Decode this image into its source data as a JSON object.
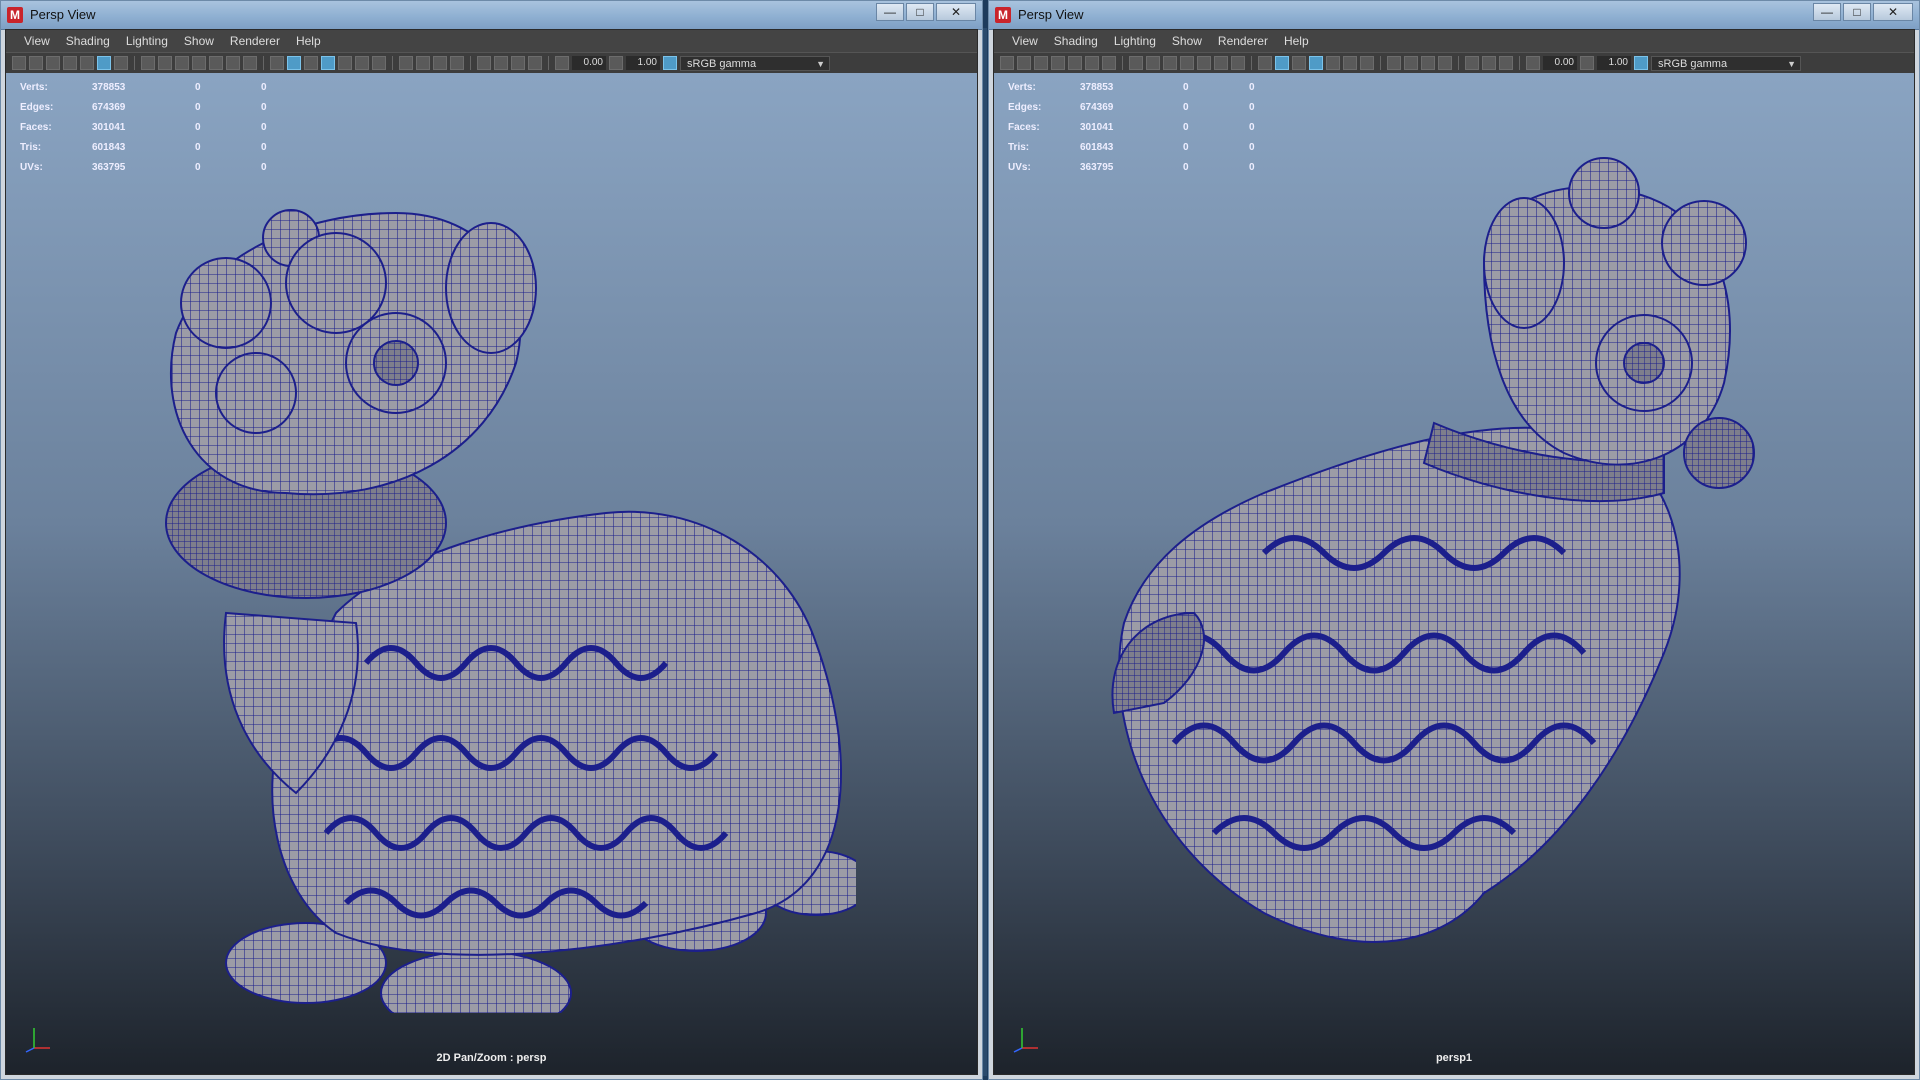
{
  "window_left": {
    "title": "Persp View",
    "menu": [
      "View",
      "Shading",
      "Lighting",
      "Show",
      "Renderer",
      "Help"
    ],
    "exposure": "0.00",
    "gamma": "1.00",
    "colorspace": "sRGB gamma",
    "camera_label": "2D Pan/Zoom : persp"
  },
  "window_right": {
    "title": "Persp View",
    "menu": [
      "View",
      "Shading",
      "Lighting",
      "Show",
      "Renderer",
      "Help"
    ],
    "exposure": "0.00",
    "gamma": "1.00",
    "colorspace": "sRGB gamma",
    "camera_label": "persp1"
  },
  "hud": {
    "rows": [
      {
        "label": "Verts:",
        "v1": "378853",
        "v2": "0",
        "v3": "0"
      },
      {
        "label": "Edges:",
        "v1": "674369",
        "v2": "0",
        "v3": "0"
      },
      {
        "label": "Faces:",
        "v1": "301041",
        "v2": "0",
        "v3": "0"
      },
      {
        "label": "Tris:",
        "v1": "601843",
        "v2": "0",
        "v3": "0"
      },
      {
        "label": "UVs:",
        "v1": "363795",
        "v2": "0",
        "v3": "0"
      }
    ]
  },
  "window_buttons": {
    "minimize": "—",
    "maximize": "□",
    "close": "✕"
  },
  "app_icon": "M",
  "icons": {
    "app": "maya-logo-icon",
    "axis": "axis-gizmo-icon",
    "dropdown": "chevron-down-icon"
  },
  "colors": {
    "wireframe": "#1c1f8c",
    "mesh_fill": "#9a9aa3",
    "viewport_top": "#8aa4c2",
    "viewport_bottom": "#1d232b"
  }
}
